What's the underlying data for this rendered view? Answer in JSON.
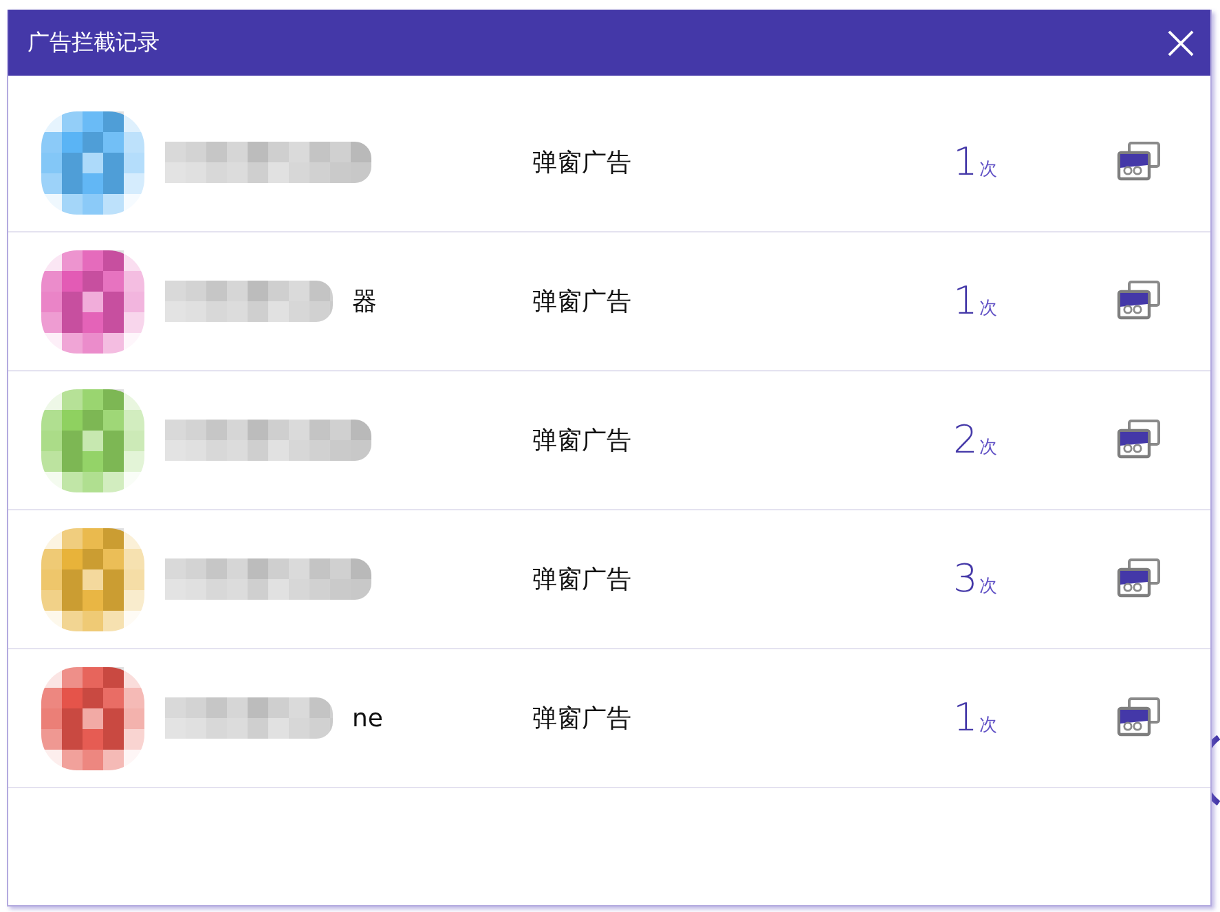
{
  "window": {
    "title": "广告拦截记录"
  },
  "records": [
    {
      "color": "#5ab4f5",
      "ad_type": "弹窗广告",
      "count": "1",
      "unit": "次"
    },
    {
      "color": "#e35bb5",
      "name_fragment": "器",
      "ad_type": "弹窗广告",
      "count": "1",
      "unit": "次"
    },
    {
      "color": "#8fd160",
      "ad_type": "弹窗广告",
      "count": "2",
      "unit": "次"
    },
    {
      "color": "#e8b33a",
      "ad_type": "弹窗广告",
      "count": "3",
      "unit": "次"
    },
    {
      "color": "#e5544a",
      "name_fragment": "ne",
      "ad_type": "弹窗广告",
      "count": "1",
      "unit": "次"
    }
  ]
}
